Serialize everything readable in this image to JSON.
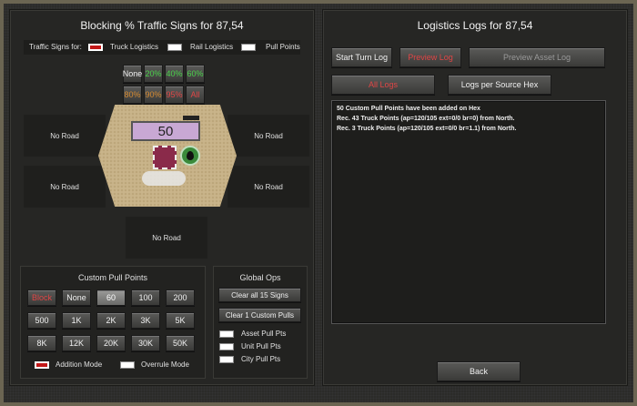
{
  "left": {
    "title": "Blocking % Traffic Signs for 87,54",
    "legend": {
      "label": "Traffic Signs for:",
      "truck": "Truck Logistics",
      "rail": "Rail Logistics",
      "pull": "Pull Points"
    },
    "pct_row1": [
      "None",
      "20%",
      "40%",
      "60%"
    ],
    "pct_row2": [
      "80%",
      "90%",
      "95%",
      "All"
    ],
    "no_road": "No Road",
    "hex_value": "50",
    "custom": {
      "title": "Custom Pull Points",
      "row1": [
        "Block",
        "None",
        "60",
        "100",
        "200"
      ],
      "row2": [
        "500",
        "1K",
        "2K",
        "3K",
        "5K"
      ],
      "row3": [
        "8K",
        "12K",
        "20K",
        "30K",
        "50K"
      ],
      "addition": "Addition Mode",
      "overrule": "Overrule Mode"
    },
    "global": {
      "title": "Global Ops",
      "clear_signs": "Clear all 15 Signs",
      "clear_custom": "Clear 1 Custom Pulls",
      "asset": "Asset Pull Pts",
      "unit": "Unit Pull Pts",
      "city": "City Pull Pts"
    }
  },
  "right": {
    "title": "Logistics Logs for 87,54",
    "buttons": {
      "start_turn": "Start Turn Log",
      "preview": "Preview Log",
      "preview_asset": "Preview Asset Log",
      "all_logs": "All Logs",
      "per_source": "Logs per Source Hex"
    },
    "log_lines": [
      "50 Custom Pull Points have been added on Hex",
      "Rec. 43 Truck Points (ap=120/105 ext=0/0 br=0) from North.",
      "Rec. 3 Truck Points (ap=120/105 ext=0/0 br=1.1) from North."
    ],
    "back": "Back"
  }
}
